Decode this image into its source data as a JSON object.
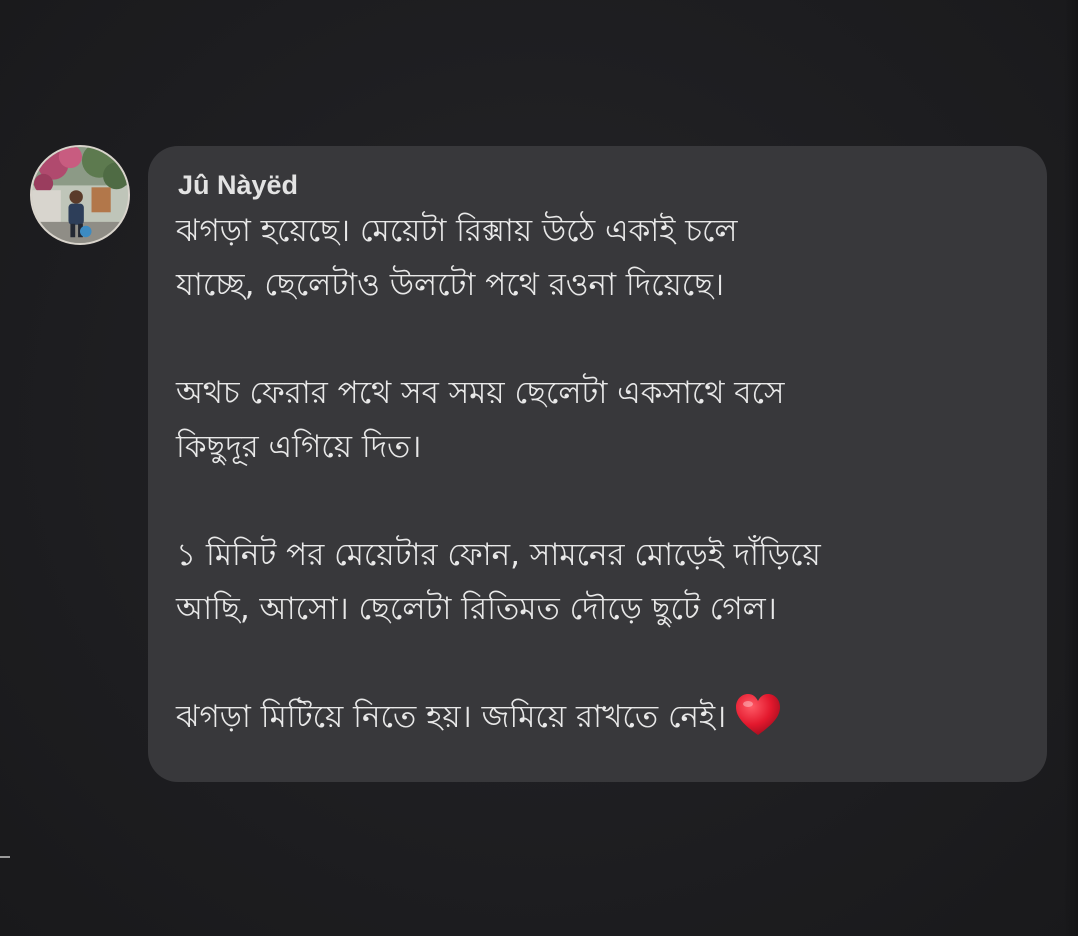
{
  "colors": {
    "background": "#1d1d20",
    "bubble": "#38383b",
    "text": "#e8e8e8",
    "author": "#e3e3e3",
    "heart": "#e3182d"
  },
  "comment": {
    "author": "Jû Nàyëd",
    "avatar_icon": "profile-photo",
    "paragraphs": [
      {
        "lines": [
          "ঝগড়া হয়েছে। মেয়েটা রিক্সায় উঠে একাই চলে",
          "যাচ্ছে, ছেলেটাও উলটো পথে রওনা দিয়েছে।"
        ]
      },
      {
        "lines": [
          "অথচ ফেরার পথে সব সময় ছেলেটা একসাথে বসে",
          "কিছুদূর এগিয়ে দিত।"
        ]
      },
      {
        "lines": [
          "১ মিনিট পর মেয়েটার ফোন, সামনের মোড়েই দাঁড়িয়ে",
          "আছি, আসো। ছেলেটা রিতিমত দৌড়ে ছুটে গেল।"
        ]
      },
      {
        "lines": [
          "ঝগড়া মিটিয়ে নিতে হয়। জমিয়ে রাখতে নেই।"
        ],
        "emoji": "heart-icon"
      }
    ]
  }
}
